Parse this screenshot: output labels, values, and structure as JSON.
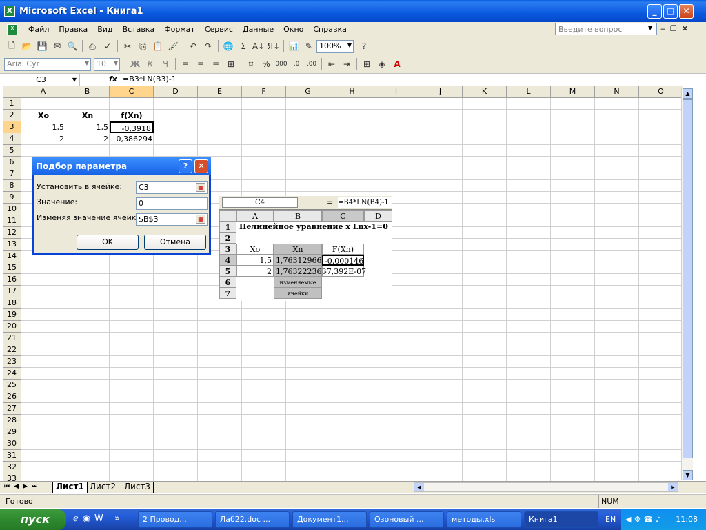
{
  "window": {
    "title": "Microsoft Excel - Книга1"
  },
  "menu": {
    "items": [
      "Файл",
      "Правка",
      "Вид",
      "Вставка",
      "Формат",
      "Сервис",
      "Данные",
      "Окно",
      "Справка"
    ],
    "ask_placeholder": "Введите вопрос"
  },
  "toolbar": {
    "zoom": "100%",
    "font": "Arial Cyr",
    "size": "10"
  },
  "formula_bar": {
    "name_box": "C3",
    "fx": "fx",
    "formula": "=B3*LN(B3)-1"
  },
  "sheet": {
    "columns": [
      "A",
      "B",
      "C",
      "D",
      "E",
      "F",
      "G",
      "H",
      "I",
      "J",
      "K",
      "L",
      "M",
      "N",
      "O"
    ],
    "rows": [
      "1",
      "2",
      "3",
      "4",
      "5",
      "6",
      "7",
      "8",
      "9",
      "10",
      "11",
      "12",
      "13",
      "14",
      "15",
      "16",
      "17",
      "18",
      "19",
      "20",
      "21",
      "22",
      "23",
      "24",
      "25",
      "26",
      "27",
      "28",
      "29",
      "30",
      "31",
      "32",
      "33"
    ],
    "cells": {
      "A2": "Xo",
      "B2": "Xn",
      "C2": "f(Xn)",
      "A3": "1,5",
      "B3": "1,5",
      "C3": "-0,3918",
      "A4": "2",
      "B4": "2",
      "C4": "0,386294"
    }
  },
  "sheet_tabs": [
    "Лист1",
    "Лист2",
    "Лист3"
  ],
  "status": {
    "left": "Готово",
    "num": "NUM"
  },
  "dialog": {
    "title": "Подбор параметра",
    "set_cell_label": "Установить в ячейке:",
    "set_cell_value": "C3",
    "value_label": "Значение:",
    "value_value": "0",
    "changing_label": "Изменяя значение ячейки:",
    "changing_value": "$B$3",
    "ok": "OK",
    "cancel": "Отмена"
  },
  "embedded_image": {
    "name_box": "C4",
    "eq": "=",
    "formula": "=B4*LN(B4)-1",
    "cols": [
      "A",
      "B",
      "C",
      "D"
    ],
    "rows": [
      "1",
      "2",
      "3",
      "4",
      "5",
      "6",
      "7"
    ],
    "r1": "Нелинейное уравнение  x Lnx-1=0",
    "a3": "Xo",
    "b3": "Xn",
    "c3": "F(Xn)",
    "a4": "1,5",
    "b4": "1,76312966",
    "c4": "-0,000146",
    "a5": "2",
    "b5": "1,763222363",
    "c5": "-7,392E-07",
    "b6": "изменяемые",
    "b7": "ячейки"
  },
  "taskbar": {
    "start": "пуск",
    "tasks": [
      "2 Провод...",
      "Лаб22.doc ...",
      "Документ1...",
      "Озоновый ...",
      "методы.xls",
      "Книга1"
    ],
    "lang": "EN",
    "time": "11:08"
  }
}
